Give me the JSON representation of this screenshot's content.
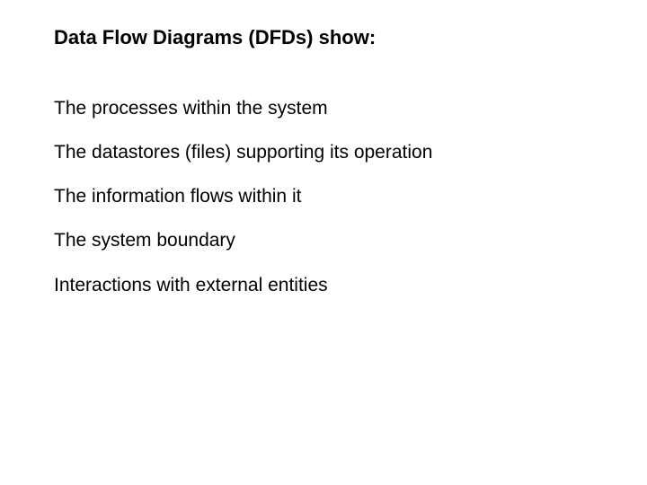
{
  "title": "Data Flow Diagrams (DFDs) show:",
  "items": [
    "The processes within the system",
    "The datastores (files) supporting its operation",
    "The information flows within it",
    "The system boundary",
    "Interactions with external entities"
  ]
}
